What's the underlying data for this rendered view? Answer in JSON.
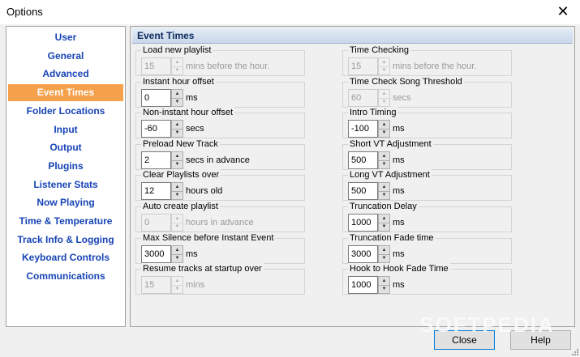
{
  "window": {
    "title": "Options"
  },
  "sidebar": {
    "items": [
      {
        "label": "User",
        "active": false
      },
      {
        "label": "General",
        "active": false
      },
      {
        "label": "Advanced",
        "active": false
      },
      {
        "label": "Event Times",
        "active": true
      },
      {
        "label": "Folder Locations",
        "active": false
      },
      {
        "label": "Input",
        "active": false
      },
      {
        "label": "Output",
        "active": false
      },
      {
        "label": "Plugins",
        "active": false
      },
      {
        "label": "Listener Stats",
        "active": false
      },
      {
        "label": "Now Playing",
        "active": false
      },
      {
        "label": "Time & Temperature",
        "active": false
      },
      {
        "label": "Track Info & Logging",
        "active": false
      },
      {
        "label": "Keyboard Controls",
        "active": false
      },
      {
        "label": "Communications",
        "active": false
      }
    ]
  },
  "panel": {
    "title": "Event Times",
    "left": [
      {
        "label": "Load new playlist",
        "value": "15",
        "unit": "mins before the hour.",
        "enabled": false
      },
      {
        "label": "Instant hour offset",
        "value": "0",
        "unit": "ms",
        "enabled": true
      },
      {
        "label": "Non-instant hour offset",
        "value": "-60",
        "unit": "secs",
        "enabled": true
      },
      {
        "label": "Preload New Track",
        "value": "2",
        "unit": "secs in advance",
        "enabled": true
      },
      {
        "label": "Clear Playlists over",
        "value": "12",
        "unit": "hours old",
        "enabled": true
      },
      {
        "label": "Auto create playlist",
        "value": "0",
        "unit": "hours in advance",
        "enabled": false
      },
      {
        "label": "Max Silence before Instant Event",
        "value": "3000",
        "unit": "ms",
        "enabled": true
      },
      {
        "label": "Resume tracks at startup over",
        "value": "15",
        "unit": "mins",
        "enabled": false
      }
    ],
    "right": [
      {
        "label": "Time Checking",
        "value": "15",
        "unit": "mins before the hour.",
        "enabled": false
      },
      {
        "label": "Time Check Song Threshold",
        "value": "60",
        "unit": "secs",
        "enabled": false
      },
      {
        "label": "Intro Timing",
        "value": "-100",
        "unit": "ms",
        "enabled": true
      },
      {
        "label": "Short VT Adjustment",
        "value": "500",
        "unit": "ms",
        "enabled": true
      },
      {
        "label": "Long VT Adjustment",
        "value": "500",
        "unit": "ms",
        "enabled": true
      },
      {
        "label": "Truncation Delay",
        "value": "1000",
        "unit": "ms",
        "enabled": true
      },
      {
        "label": "Truncation Fade time",
        "value": "3000",
        "unit": "ms",
        "enabled": true
      },
      {
        "label": "Hook to Hook Fade Time",
        "value": "1000",
        "unit": "ms",
        "enabled": true
      }
    ]
  },
  "buttons": {
    "close_label": "Close",
    "help_label": "Help"
  },
  "watermark": "SOFTPEDIA",
  "colors": {
    "accent": "#f5a04a",
    "link": "#1744b5",
    "header": "#c9d7ea"
  },
  "icons": {
    "spin_up": "▲",
    "spin_down": "▼",
    "close": "✕"
  }
}
